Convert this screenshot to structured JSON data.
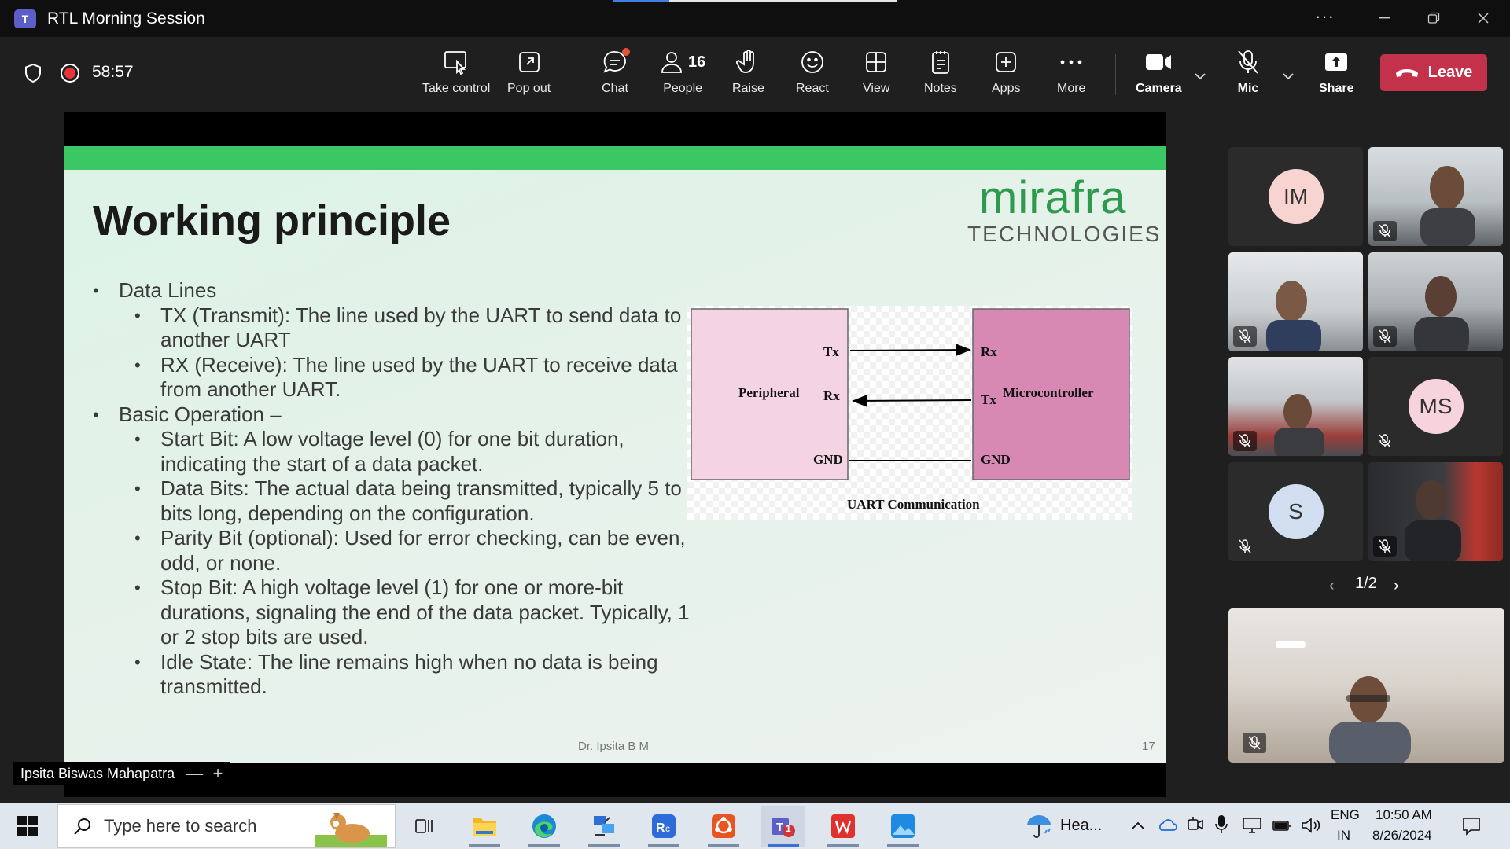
{
  "window": {
    "title": "RTL Morning Session"
  },
  "toolbar": {
    "timer": "58:57",
    "buttons": {
      "take_control": "Take control",
      "pop_out": "Pop out",
      "chat": "Chat",
      "people": "People",
      "people_count": "16",
      "raise": "Raise",
      "react": "React",
      "view": "View",
      "notes": "Notes",
      "apps": "Apps",
      "more": "More",
      "camera": "Camera",
      "mic": "Mic",
      "share": "Share",
      "leave": "Leave"
    }
  },
  "slide": {
    "title": "Working principle",
    "brand": "mirafra",
    "brand_sub": "TECHNOLOGIES",
    "bullets": [
      {
        "level": 1,
        "text": "Data Lines"
      },
      {
        "level": 2,
        "text": "TX (Transmit): The line used by the UART to send data to another UART"
      },
      {
        "level": 2,
        "text": "RX (Receive): The line used by the UART to receive data from another UART."
      },
      {
        "level": 1,
        "text": "Basic Operation –"
      },
      {
        "level": 2,
        "text": "Start Bit: A low voltage level (0) for one bit duration, indicating the start of a data packet."
      },
      {
        "level": 2,
        "text": "Data Bits: The actual data being transmitted, typically 5 to 9 bits long, depending on the configuration."
      },
      {
        "level": 2,
        "text": "Parity Bit (optional): Used for error checking, can be even, odd, or none."
      },
      {
        "level": 2,
        "text": "Stop Bit: A high voltage level (1) for one or more-bit durations, signaling the end of the data packet. Typically, 1 or 2 stop bits are used."
      },
      {
        "level": 2,
        "text": "Idle State: The line remains high when no data is being transmitted."
      }
    ],
    "diagram": {
      "left_box": "Peripheral",
      "right_box": "Microcontroller",
      "left_pins": [
        "Tx",
        "Rx",
        "GND"
      ],
      "right_pins": [
        "Rx",
        "Tx",
        "GND"
      ],
      "caption": "UART Communication"
    },
    "footer": "Dr. Ipsita B M",
    "page_number": "17"
  },
  "presenter": {
    "name": "Ipsita Biswas Mahapatra",
    "zoom_out": "—",
    "zoom_in": "+"
  },
  "participants": {
    "avatars": [
      {
        "initials": "IM",
        "color": "#f7d4cf"
      },
      {
        "initials": "MS",
        "color": "#f7d3de"
      },
      {
        "initials": "S",
        "color": "#d2dff0"
      }
    ],
    "pager": "1/2"
  },
  "taskbar": {
    "search_placeholder": "Type here to search",
    "weather": "Hea...",
    "language_top": "ENG",
    "language_bottom": "IN",
    "time": "10:50 AM",
    "date": "8/26/2024",
    "teams_badge": "1"
  }
}
